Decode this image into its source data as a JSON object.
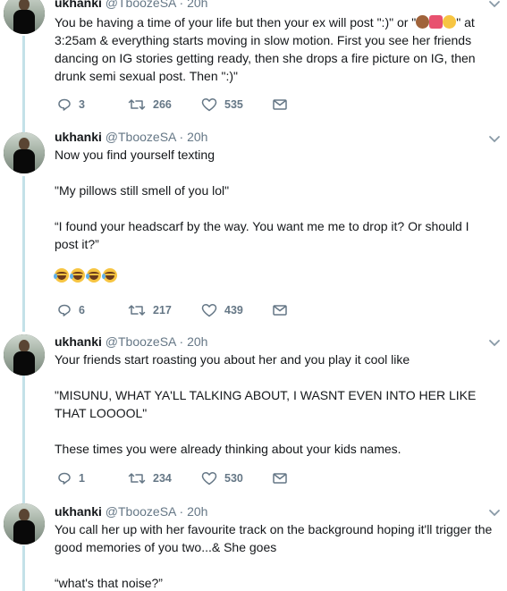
{
  "colors": {
    "thread_line": "#c4e1e8",
    "text": "#14171a",
    "muted": "#657786"
  },
  "tweets": [
    {
      "name": "ukhanki",
      "handle": "@TboozeSA",
      "time": "20h",
      "lines": [
        "You be having a time of your life but then your ex will post \":)\" or \"",
        "\" at",
        "3:25am & everything starts moving in slow motion. First you see her friends",
        "dancing on IG stories getting ready, then she drops a fire picture on IG, then",
        "drunk semi sexual post. Then \":)\""
      ],
      "inline_emojis": [
        "see-no-evil-monkey",
        "two-hearts",
        "heart-eyes"
      ],
      "replies": "3",
      "retweets": "266",
      "likes": "535"
    },
    {
      "name": "ukhanki",
      "handle": "@TboozeSA",
      "time": "20h",
      "paragraphs": [
        "Now you find yourself texting",
        "\"My pillows still smell of you lol\"",
        "“I found your headscarf by the way. You want me me to drop it? Or should I post it?”"
      ],
      "emojis": [
        "joy",
        "joy",
        "joy",
        "joy"
      ],
      "replies": "6",
      "retweets": "217",
      "likes": "439"
    },
    {
      "name": "ukhanki",
      "handle": "@TboozeSA",
      "time": "20h",
      "paragraphs": [
        "Your friends start roasting you about her and you play it cool like",
        "\"MISUNU, WHAT YA'LL TALKING ABOUT, I WASNT EVEN INTO HER LIKE THAT LOOOOL\"",
        "These times you were already thinking about your kids names."
      ],
      "replies": "1",
      "retweets": "234",
      "likes": "530"
    },
    {
      "name": "ukhanki",
      "handle": "@TboozeSA",
      "time": "20h",
      "paragraphs": [
        "You call her up with her favourite track on the background hoping it'll trigger the good memories of you two...& She goes",
        "“what's that noise?”"
      ]
    }
  ]
}
